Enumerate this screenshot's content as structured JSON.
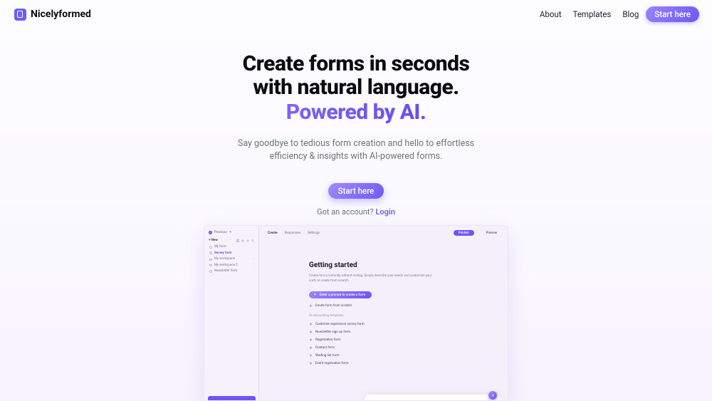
{
  "nav": {
    "brand": "Nicelyformed",
    "links": [
      "About",
      "Templates",
      "Blog"
    ],
    "cta": "Start here"
  },
  "hero": {
    "line1": "Create forms in seconds",
    "line2": "with natural language.",
    "line3": "Powered by AI.",
    "sub1": "Say goodbye to tedious form creation and hello to effortless",
    "sub2": "efficiency & insights with AI-powered forms.",
    "cta": "Start here",
    "login_prefix": "Got an account? ",
    "login_link": "Login"
  },
  "preview": {
    "workspace": "Precious",
    "sidebar_new": "New",
    "sidebar_items": [
      {
        "label": "My form",
        "active": false,
        "kind": "doc"
      },
      {
        "label": "Survey form",
        "active": true,
        "kind": "doc"
      },
      {
        "label": "My workspace",
        "active": false,
        "kind": "folder"
      },
      {
        "label": "My workspace 2",
        "active": false,
        "kind": "folder"
      },
      {
        "label": "Newsletter form",
        "active": false,
        "kind": "doc"
      }
    ],
    "tabs": [
      "Create",
      "Responses",
      "Settings"
    ],
    "publish": "Publish",
    "preview": "Preview",
    "getting_started_title": "Getting started",
    "getting_started_sub": "Create forms instantly without coding. Simply describe your needs and customize your craft, or create from scratch.",
    "primary_action": "Enter a prompt to create a form",
    "scratch_action": "Create form from scratch",
    "templates_hint": "Or use existing templates",
    "templates": [
      "Customer experience survey form",
      "Newsletter sign up form",
      "Registration form",
      "Contact form",
      "Waiting list form",
      "Event registration form"
    ]
  }
}
